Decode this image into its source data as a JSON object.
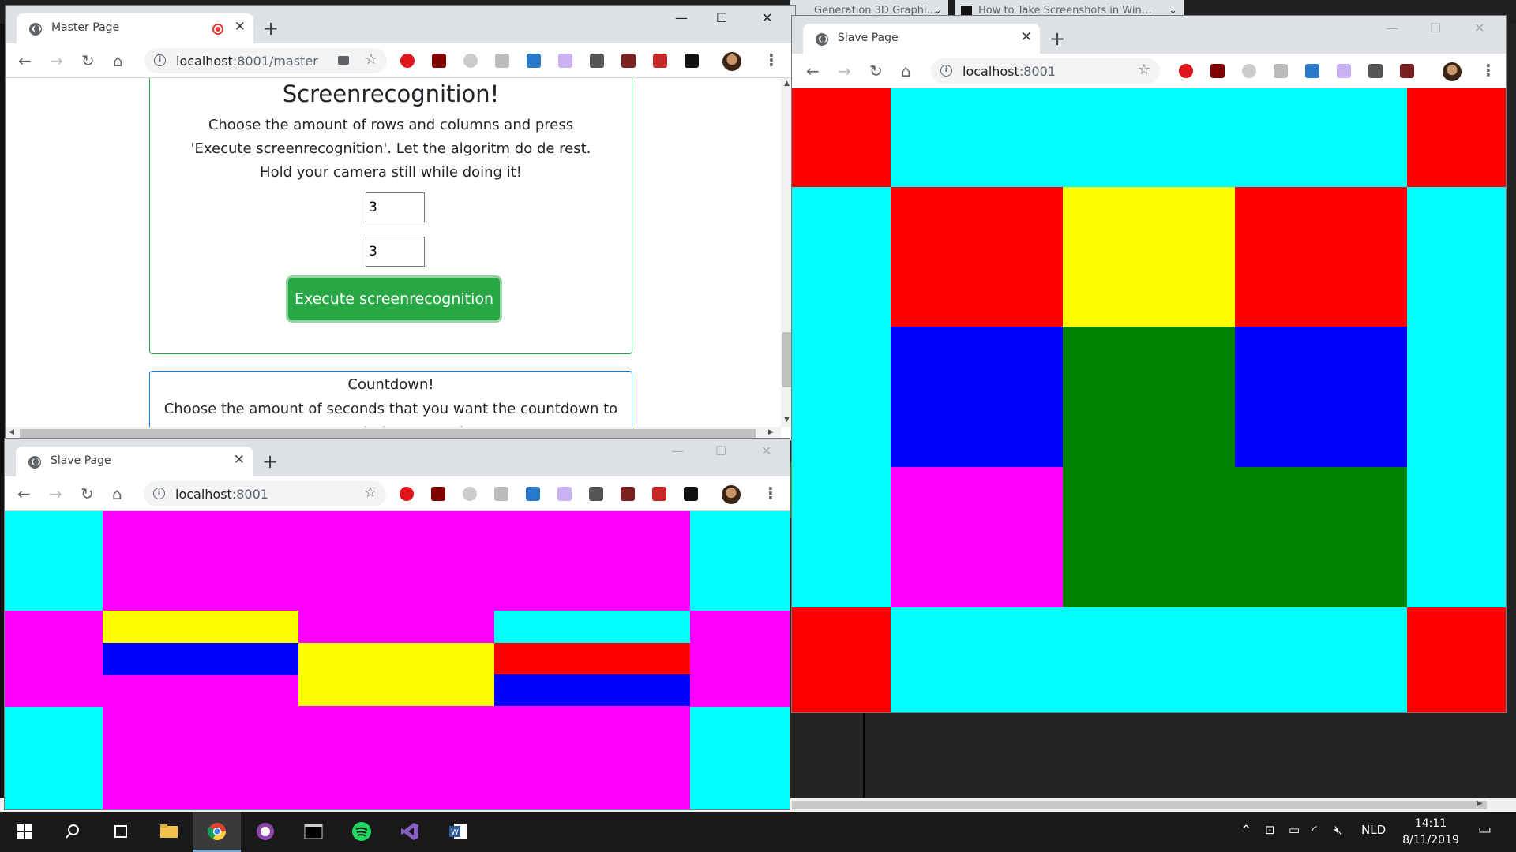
{
  "background_tabs": [
    {
      "title": "Generation 3D Graphi…"
    },
    {
      "title": "How to Take Screenshots in Win…"
    }
  ],
  "master_window": {
    "tab_title": "Master Page",
    "url_host": "localhost",
    "url_port_path": ":8001/master",
    "card1": {
      "title": "Screenrecognition!",
      "description": "Choose the amount of rows and columns and press 'Execute screenrecognition'. Let the algoritm do de rest. Hold your camera still while doing it!",
      "rows_value": "3",
      "columns_value": "3",
      "button_label": "Execute screenrecognition"
    },
    "card2": {
      "title": "Countdown!",
      "description": "Choose the amount of seconds that you want the countdown to count during a round."
    }
  },
  "slave_window_small": {
    "tab_title": "Slave Page",
    "url_host": "localhost",
    "url_port_path": ":8001"
  },
  "slave_window_large": {
    "tab_title": "Slave Page",
    "url_host": "localhost",
    "url_port_path": ":8001"
  },
  "colors": {
    "cyan": "#00ffff",
    "red": "#ff0000",
    "yellow": "#ffff00",
    "blue": "#0000ff",
    "green": "#008000",
    "magenta": "#ff00ff",
    "accent_green": "#28a745"
  },
  "taskbar": {
    "apps": [
      "windows-start",
      "search",
      "task-view",
      "file-explorer",
      "chrome",
      "github-desktop",
      "terminal",
      "spotify",
      "visual-studio",
      "word"
    ],
    "language": "NLD",
    "time": "14:11",
    "date": "8/11/2019"
  }
}
